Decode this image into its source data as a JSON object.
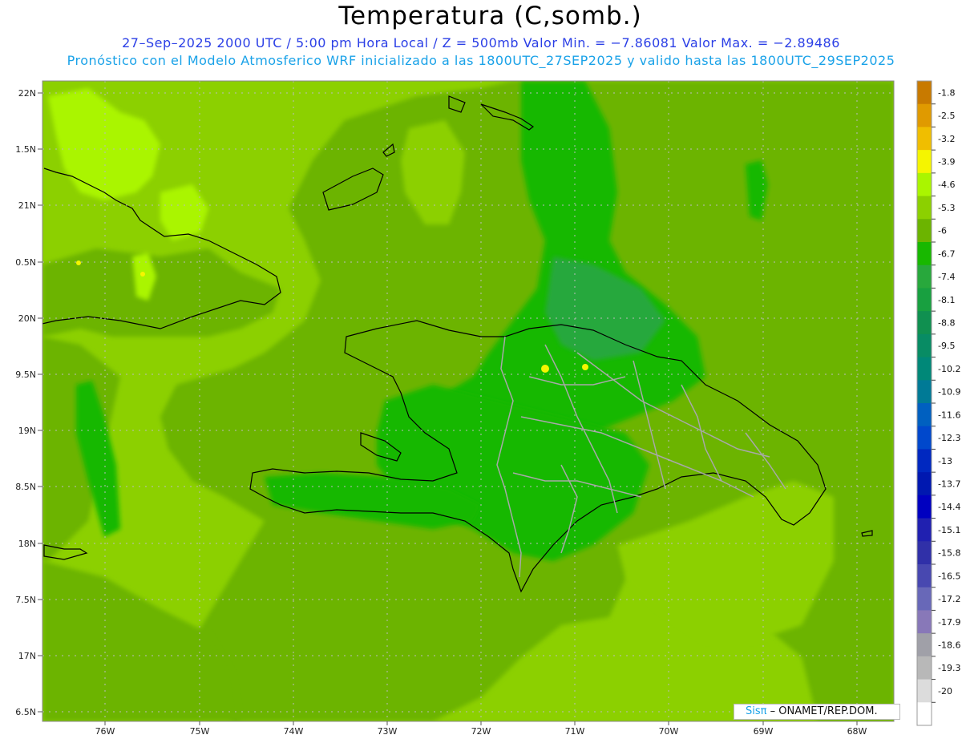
{
  "title": "Temperatura (C,somb.)",
  "subtitle_line1": "27–Sep–2025   2000 UTC / 5:00 pm Hora Local / Z = 500mb   Valor Min. = −7.86081   Valor Max. = −2.89486",
  "subtitle_line2": "Pronóstico con el Modelo Atmosferico WRF inicializado a las 1800UTC_27SEP2025 y valido hasta las  1800UTC_29SEP2025",
  "map": {
    "lat_labels": [
      "22N",
      "1.5N",
      "21N",
      "0.5N",
      "20N",
      "9.5N",
      "19N",
      "8.5N",
      "18N",
      "7.5N",
      "17N",
      "6.5N"
    ],
    "lon_labels": [
      "76W",
      "75W",
      "74W",
      "73W",
      "72W",
      "71W",
      "70W",
      "69W",
      "68W"
    ],
    "lat_range": [
      16.5,
      22.0
    ],
    "lon_range": [
      -76.65,
      -67.6
    ],
    "base_color": "#8cd000"
  },
  "colorbar": {
    "labels": [
      "-1.8",
      "-2.5",
      "-3.2",
      "-3.9",
      "-4.6",
      "-5.3",
      "-6",
      "-6.7",
      "-7.4",
      "-8.1",
      "-8.8",
      "-9.5",
      "-10.2",
      "-10.9",
      "-11.6",
      "-12.3",
      "-13",
      "-13.7",
      "-14.4",
      "-15.1",
      "-15.8",
      "-16.5",
      "-17.2",
      "-17.9",
      "-18.6",
      "-19.3",
      "-20"
    ],
    "colors": [
      "#c87a00",
      "#e09a00",
      "#f0be00",
      "#f5f500",
      "#aaf500",
      "#8cd000",
      "#6cb400",
      "#18b800",
      "#28a83c",
      "#18a040",
      "#109050",
      "#088c64",
      "#008878",
      "#007a96",
      "#0060c0",
      "#0048cc",
      "#0028c0",
      "#0018b0",
      "#0000c0",
      "#2020b0",
      "#3030a8",
      "#4848b0",
      "#6868b8",
      "#8878b8",
      "#a0a0a8",
      "#b8b8b8",
      "#dcdcdc",
      "#ffffff"
    ]
  },
  "credit": {
    "brand": "Sisπ",
    "org": " – ONAMET/REP.DOM."
  }
}
